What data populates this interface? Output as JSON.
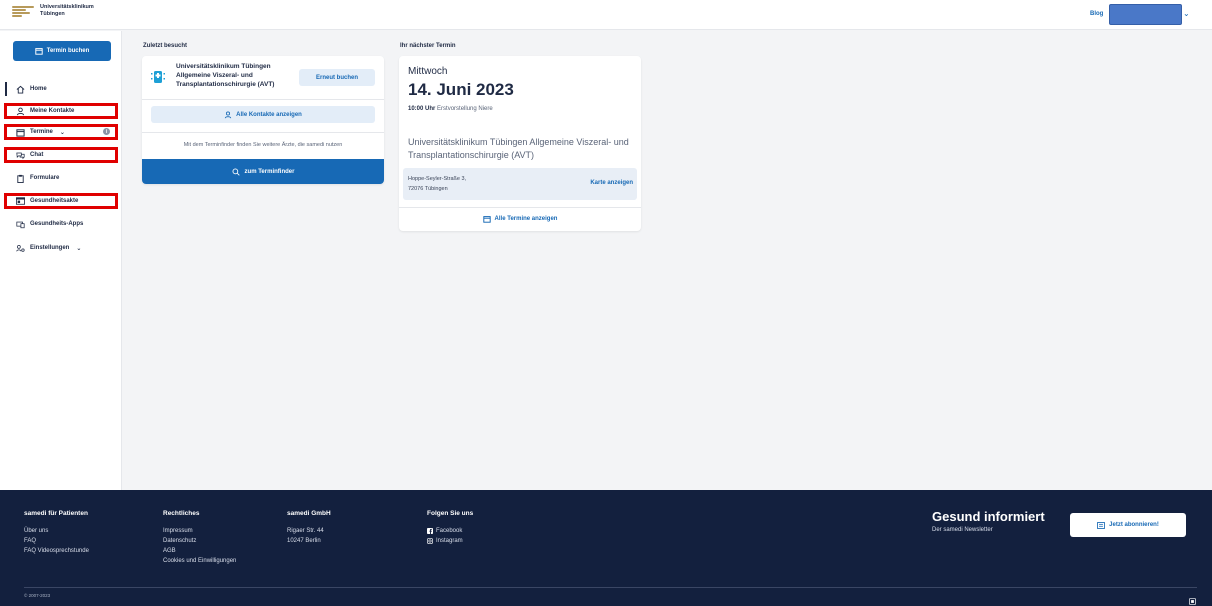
{
  "header": {
    "logo_line1": "Universitätsklinikum",
    "logo_line2": "Tübingen",
    "blog": "Blog",
    "colors": {
      "brand": "#1769b5",
      "gold": "#b79a5a"
    }
  },
  "sidebar": {
    "book_button": "Termin buchen",
    "items": [
      {
        "label": "Home",
        "icon": "home-icon"
      },
      {
        "label": "Meine Kontakte",
        "icon": "person-icon"
      },
      {
        "label": "Termine",
        "icon": "calendar-icon"
      },
      {
        "label": "Chat",
        "icon": "chat-icon"
      },
      {
        "label": "Formulare",
        "icon": "clipboard-icon"
      },
      {
        "label": "Gesundheitsakte",
        "icon": "id-card-icon"
      },
      {
        "label": "Gesundheits-Apps",
        "icon": "apps-icon"
      },
      {
        "label": "Einstellungen",
        "icon": "settings-icon"
      }
    ]
  },
  "recent": {
    "title": "Zuletzt besucht",
    "name": "Universitätsklinikum Tübingen Allgemeine Viszeral- und Transplantationschirurgie (AVT)",
    "rebook": "Erneut buchen",
    "all_contacts": "Alle Kontakte anzeigen",
    "finder_text": "Mit dem Terminfinder finden Sie weitere Ärzte, die samedi nutzen",
    "finder_button": "zum Terminfinder"
  },
  "next": {
    "title": "Ihr nächster Termin",
    "weekday": "Mittwoch",
    "date": "14. Juni 2023",
    "time": "10:00 Uhr",
    "type": "Erstvorstellung Niere",
    "place": "Universitätsklinikum Tübingen Allgemeine Viszeral- und Transplantationschirurgie (AVT)",
    "street": "Hoppe-Seyler-Straße 3,",
    "city": "72076 Tübingen",
    "map": "Karte anzeigen",
    "all": "Alle Termine anzeigen"
  },
  "footer": {
    "col1": {
      "head": "samedi für Patienten",
      "links": [
        "Über uns",
        "FAQ",
        "FAQ Videosprechstunde"
      ]
    },
    "col2": {
      "head": "Rechtliches",
      "links": [
        "Impressum",
        "Datenschutz",
        "AGB",
        "Cookies und Einwilligungen"
      ]
    },
    "col3": {
      "head": "samedi GmbH",
      "links": [
        "Rigaer Str. 44",
        "10247 Berlin"
      ]
    },
    "col4": {
      "head": "Folgen Sie uns",
      "links": [
        "Facebook",
        "Instagram"
      ]
    },
    "news_title": "Gesund informiert",
    "news_sub": "Der samedi Newsletter",
    "subscribe": "Jetzt abonnieren!",
    "copyright": "© 2007-2023"
  }
}
